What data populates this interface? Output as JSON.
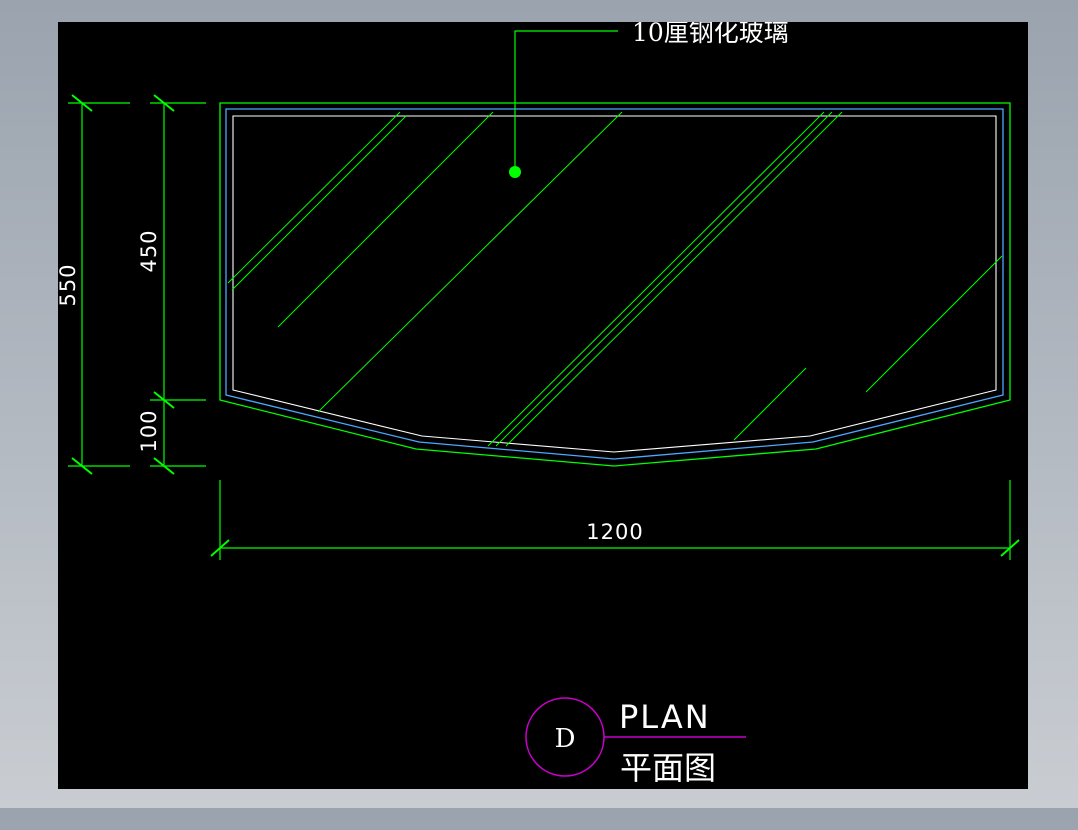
{
  "annotation": {
    "material_note": "10厘钢化玻璃"
  },
  "dimensions": {
    "overall_height": "550",
    "upper_height": "450",
    "lower_height": "100",
    "width": "1200"
  },
  "title_block": {
    "marker": "D",
    "title": "PLAN",
    "subtitle": "平面图"
  },
  "colors": {
    "canvas_background": "#000000",
    "outline": "#00ff00",
    "inner_outline": "#ffffff",
    "glass_edge": "#4aa8ff",
    "text": "#ffffff",
    "title_marker": "#cc00cc",
    "leader_dot": "#00ff00"
  }
}
